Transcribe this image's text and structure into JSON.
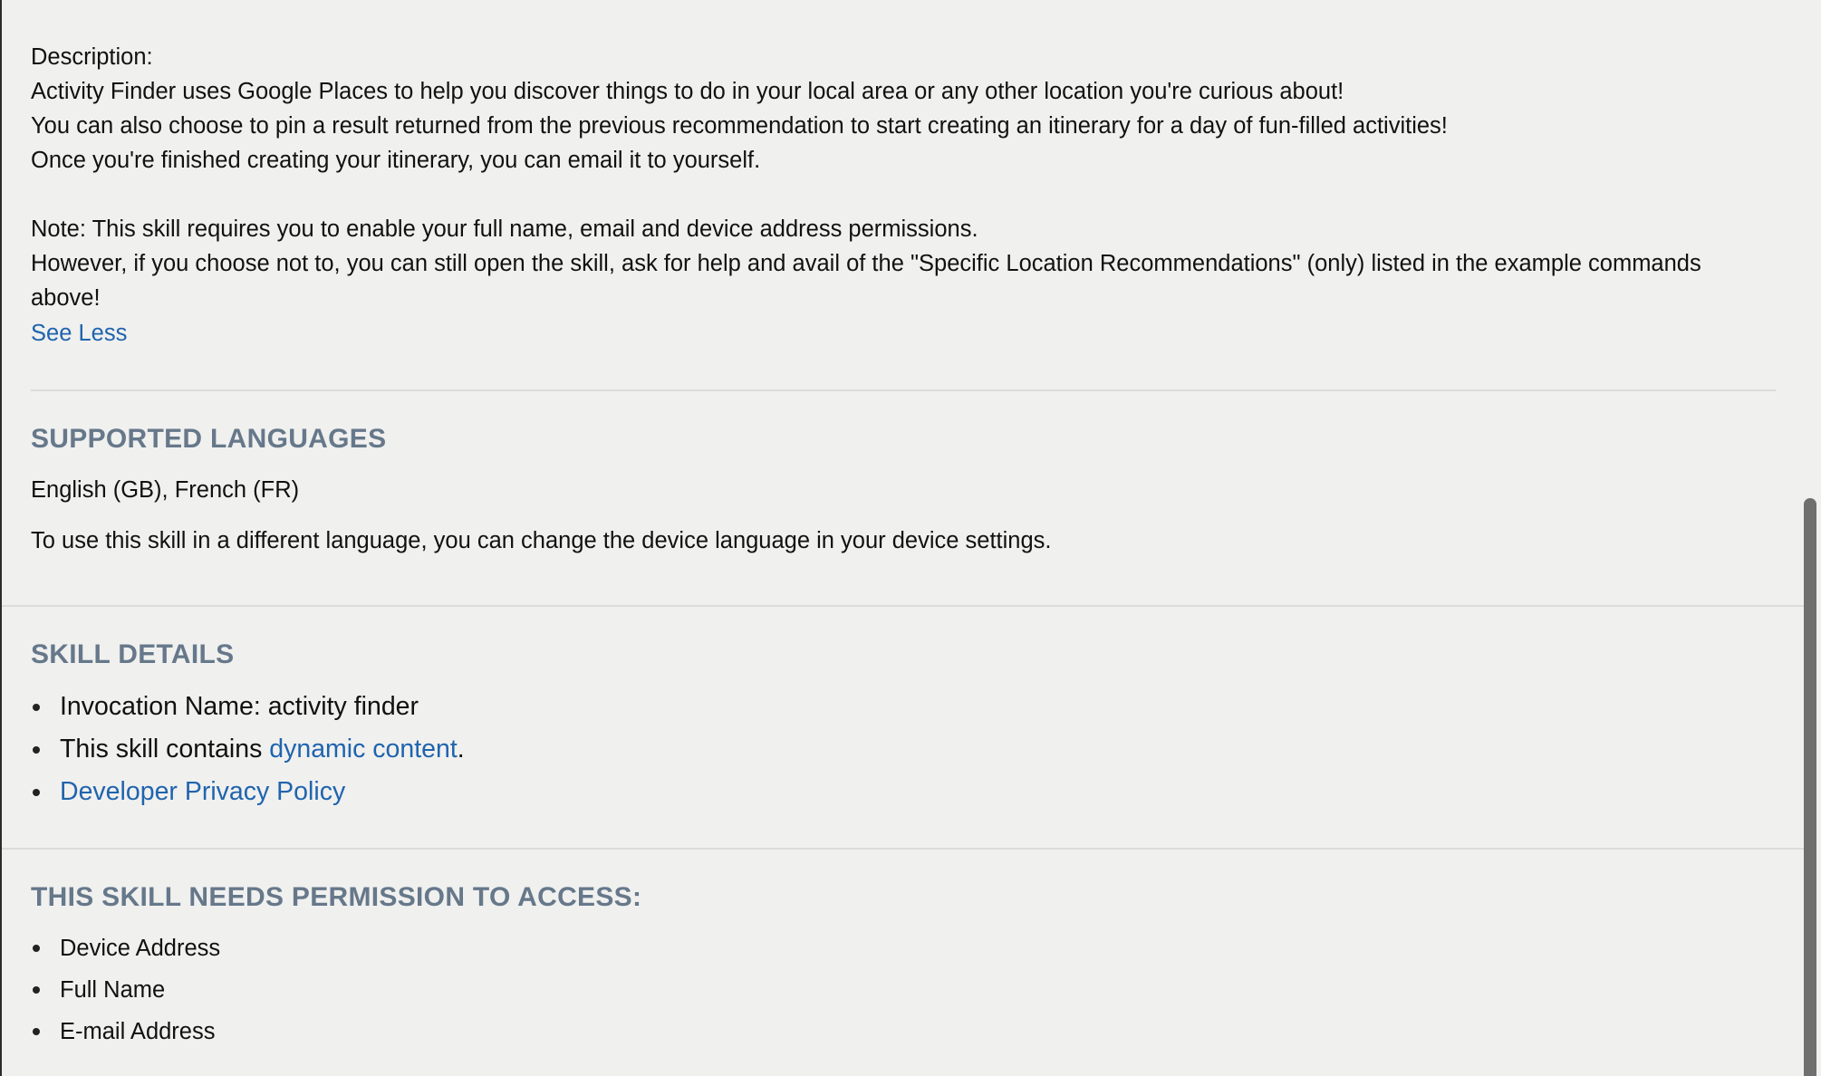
{
  "description": {
    "label": "Description:",
    "lines": [
      "Activity Finder uses Google Places to help you discover things to do in your local area or any other location you're curious about!",
      "You can also choose to pin a result returned from the previous recommendation to start creating an itinerary for a day of fun-filled activities!",
      "Once you're finished creating your itinerary, you can email it to yourself."
    ],
    "note_lines": [
      "Note: This skill requires you to enable your full name, email and device address permissions.",
      "However, if you choose not to, you can still open the skill, ask for help and avail of the \"Specific Location Recommendations\" (only) listed in the example commands above!"
    ],
    "see_less_label": "See Less"
  },
  "supported_languages": {
    "heading": "SUPPORTED LANGUAGES",
    "languages": "English (GB), French (FR)",
    "hint": "To use this skill in a different language, you can change the device language in your device settings."
  },
  "skill_details": {
    "heading": "SKILL DETAILS",
    "invocation_prefix": "Invocation Name: ",
    "invocation_name": "activity finder",
    "dynamic_prefix": "This skill contains ",
    "dynamic_link": "dynamic content",
    "dynamic_suffix": ".",
    "privacy_link": "Developer Privacy Policy"
  },
  "permissions": {
    "heading": "THIS SKILL NEEDS PERMISSION TO ACCESS:",
    "items": [
      "Device Address",
      "Full Name",
      "E-mail Address"
    ]
  },
  "colors": {
    "link": "#1f64ad",
    "heading": "#66788a",
    "background": "#f0f0ef"
  }
}
